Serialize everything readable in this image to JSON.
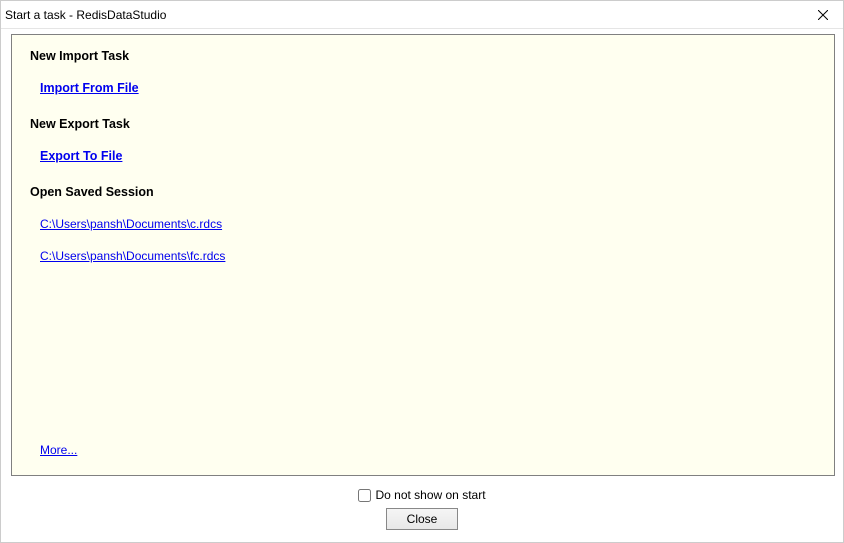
{
  "titlebar": {
    "title": "Start a task - RedisDataStudio"
  },
  "sections": {
    "import_heading": "New Import Task",
    "import_link": "Import From File",
    "export_heading": "New Export Task",
    "export_link": "Export To File",
    "sessions_heading": "Open Saved Session",
    "sessions": {
      "0": "C:\\Users\\pansh\\Documents\\c.rdcs",
      "1": "C:\\Users\\pansh\\Documents\\fc.rdcs"
    },
    "more_link": "More..."
  },
  "footer": {
    "checkbox_label": "Do not show on start",
    "close_label": "Close"
  }
}
